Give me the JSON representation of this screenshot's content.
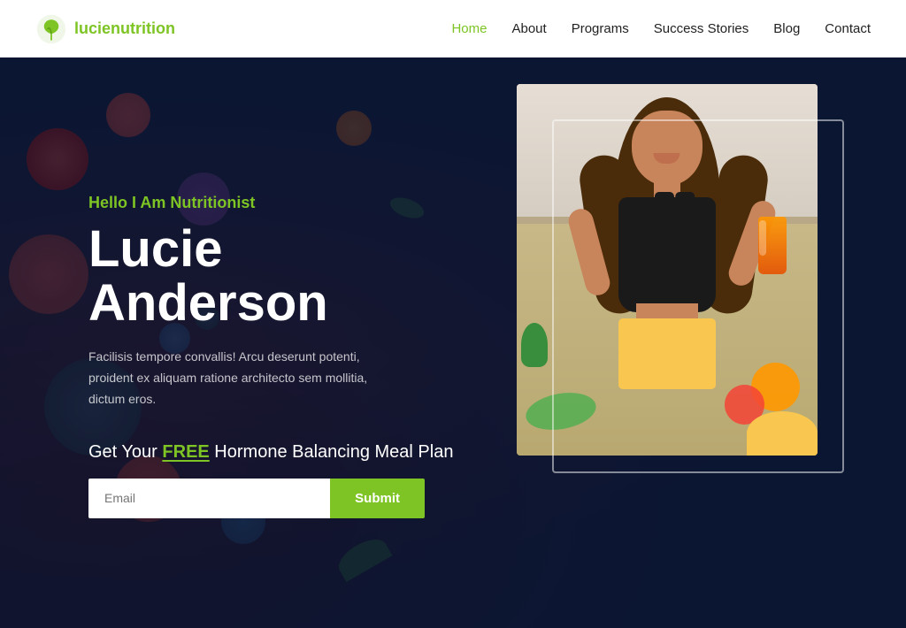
{
  "header": {
    "logo_text_prefix": "lucie",
    "logo_text_suffix": "nutrition",
    "logo_icon_alt": "leaf icon",
    "nav_items": [
      {
        "label": "Home",
        "active": true
      },
      {
        "label": "About",
        "active": false
      },
      {
        "label": "Programs",
        "active": false
      },
      {
        "label": "Success Stories",
        "active": false
      },
      {
        "label": "Blog",
        "active": false
      },
      {
        "label": "Contact",
        "active": false
      }
    ]
  },
  "hero": {
    "tagline": "Hello I Am Nutritionist",
    "name": "Lucie Anderson",
    "description": "Facilisis tempore convallis! Arcu deserunt potenti, proident ex aliquam ratione architecto sem mollitia, dictum eros.",
    "cta_text_before": "Get Your ",
    "cta_free": "FREE",
    "cta_text_after": " Hormone Balancing Meal Plan",
    "email_placeholder": "Email",
    "submit_label": "Submit"
  },
  "colors": {
    "accent": "#7dc424",
    "dark_bg": "#0f1a35",
    "white": "#ffffff"
  }
}
